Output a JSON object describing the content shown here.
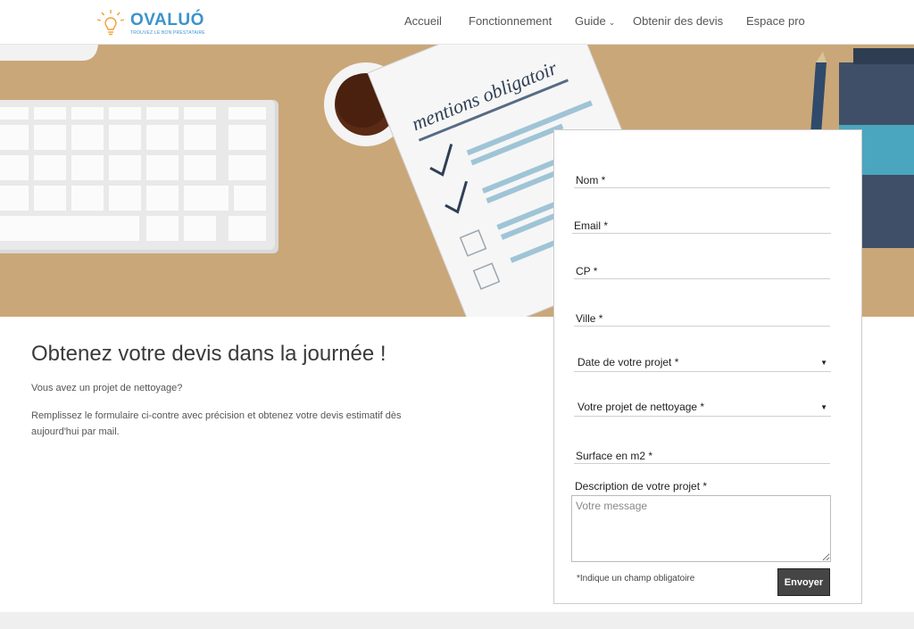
{
  "brand": {
    "name": "OVALUÓ",
    "tagline": "TROUVEZ LE BON PRESTATAIRE",
    "colors": {
      "primary": "#3a93cc",
      "accent": "#f0a030"
    }
  },
  "nav": {
    "items": [
      {
        "label": "Accueil"
      },
      {
        "label": "Fonctionnement"
      },
      {
        "label": "Guide"
      },
      {
        "label": "Obtenir des devis"
      },
      {
        "label": "Espace pro"
      }
    ],
    "caret": "⌄"
  },
  "hero": {
    "sheet_title": "mentions obligatoir",
    "background_color": "#caa778"
  },
  "intro": {
    "headline": "Obtenez votre devis dans la journée !",
    "question": "Vous avez un projet de nettoyage?",
    "body": "Remplissez le formulaire ci-contre avec précision et obtenez votre devis estimatif dès aujourd'hui par mail."
  },
  "form": {
    "nom_label": "Nom *",
    "email_label": "Email *",
    "cp_label": "CP *",
    "ville_label": "Ville *",
    "date_select": "Date de votre projet *",
    "projet_select": "Votre projet de nettoyage *",
    "surface_label": "Surface en m2 *",
    "description_label": "Description de votre projet *",
    "message_placeholder": "Votre message",
    "required_note": "*Indique un champ obligatoire",
    "submit_label": "Envoyer",
    "select_arrow": "▼"
  }
}
